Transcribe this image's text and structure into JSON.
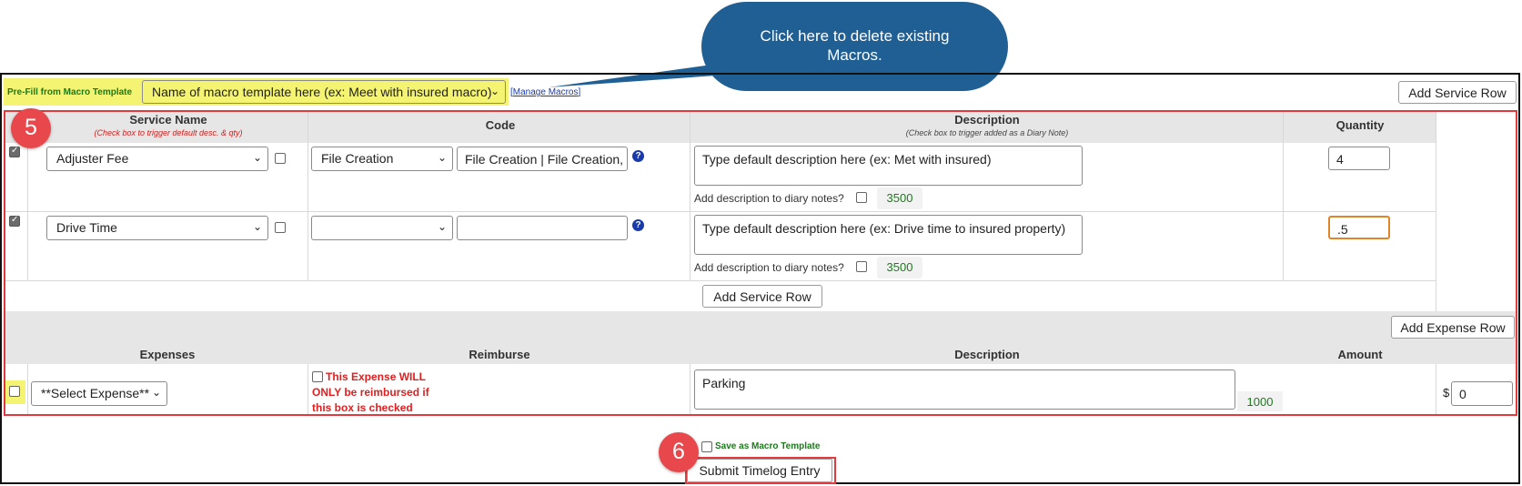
{
  "callout": {
    "text": "Click here to delete existing Macros."
  },
  "prefill": {
    "label": "Pre-Fill from Macro Template",
    "macro_select": "Name of macro template here (ex: Meet with insured macro)",
    "manage_link": "Manage Macros"
  },
  "add_service_row_top": "Add Service Row",
  "step5": "5",
  "step6": "6",
  "services": {
    "headers": {
      "service_name": "Service Name",
      "service_name_sub": "(Check box to trigger default desc. & qty)",
      "code": "Code",
      "description": "Description",
      "description_sub": "(Check box to trigger added as a Diary Note)",
      "quantity": "Quantity"
    },
    "rows": [
      {
        "service": "Adjuster Fee",
        "code_select": "File Creation",
        "code_text": "File Creation | File Creation,",
        "description": "Type default description here (ex: Met with insured)",
        "diary_label": "Add description to diary notes?",
        "char_count": "3500",
        "quantity": "4"
      },
      {
        "service": "Drive Time",
        "code_select": "",
        "code_text": "",
        "description": "Type default description here (ex: Drive time to insured property)",
        "diary_label": "Add description to diary notes?",
        "char_count": "3500",
        "quantity": ".5"
      }
    ],
    "add_row_button": "Add Service Row"
  },
  "expenses": {
    "add_row_button": "Add Expense Row",
    "headers": {
      "expenses": "Expenses",
      "reimburse": "Reimburse",
      "description": "Description",
      "amount": "Amount"
    },
    "row": {
      "expense_select": "**Select Expense**",
      "reimburse_line1": "This Expense WILL",
      "reimburse_line2": "ONLY be reimbursed if",
      "reimburse_line3": "this box is checked",
      "description": "Parking",
      "char_count": "1000",
      "currency": "$",
      "amount": "0"
    }
  },
  "footer": {
    "save_macro_label": "Save as Macro Template",
    "submit_button": "Submit Timelog Entry"
  },
  "icons": {
    "help": "help-icon",
    "dropdown": "chevron-down-icon"
  }
}
